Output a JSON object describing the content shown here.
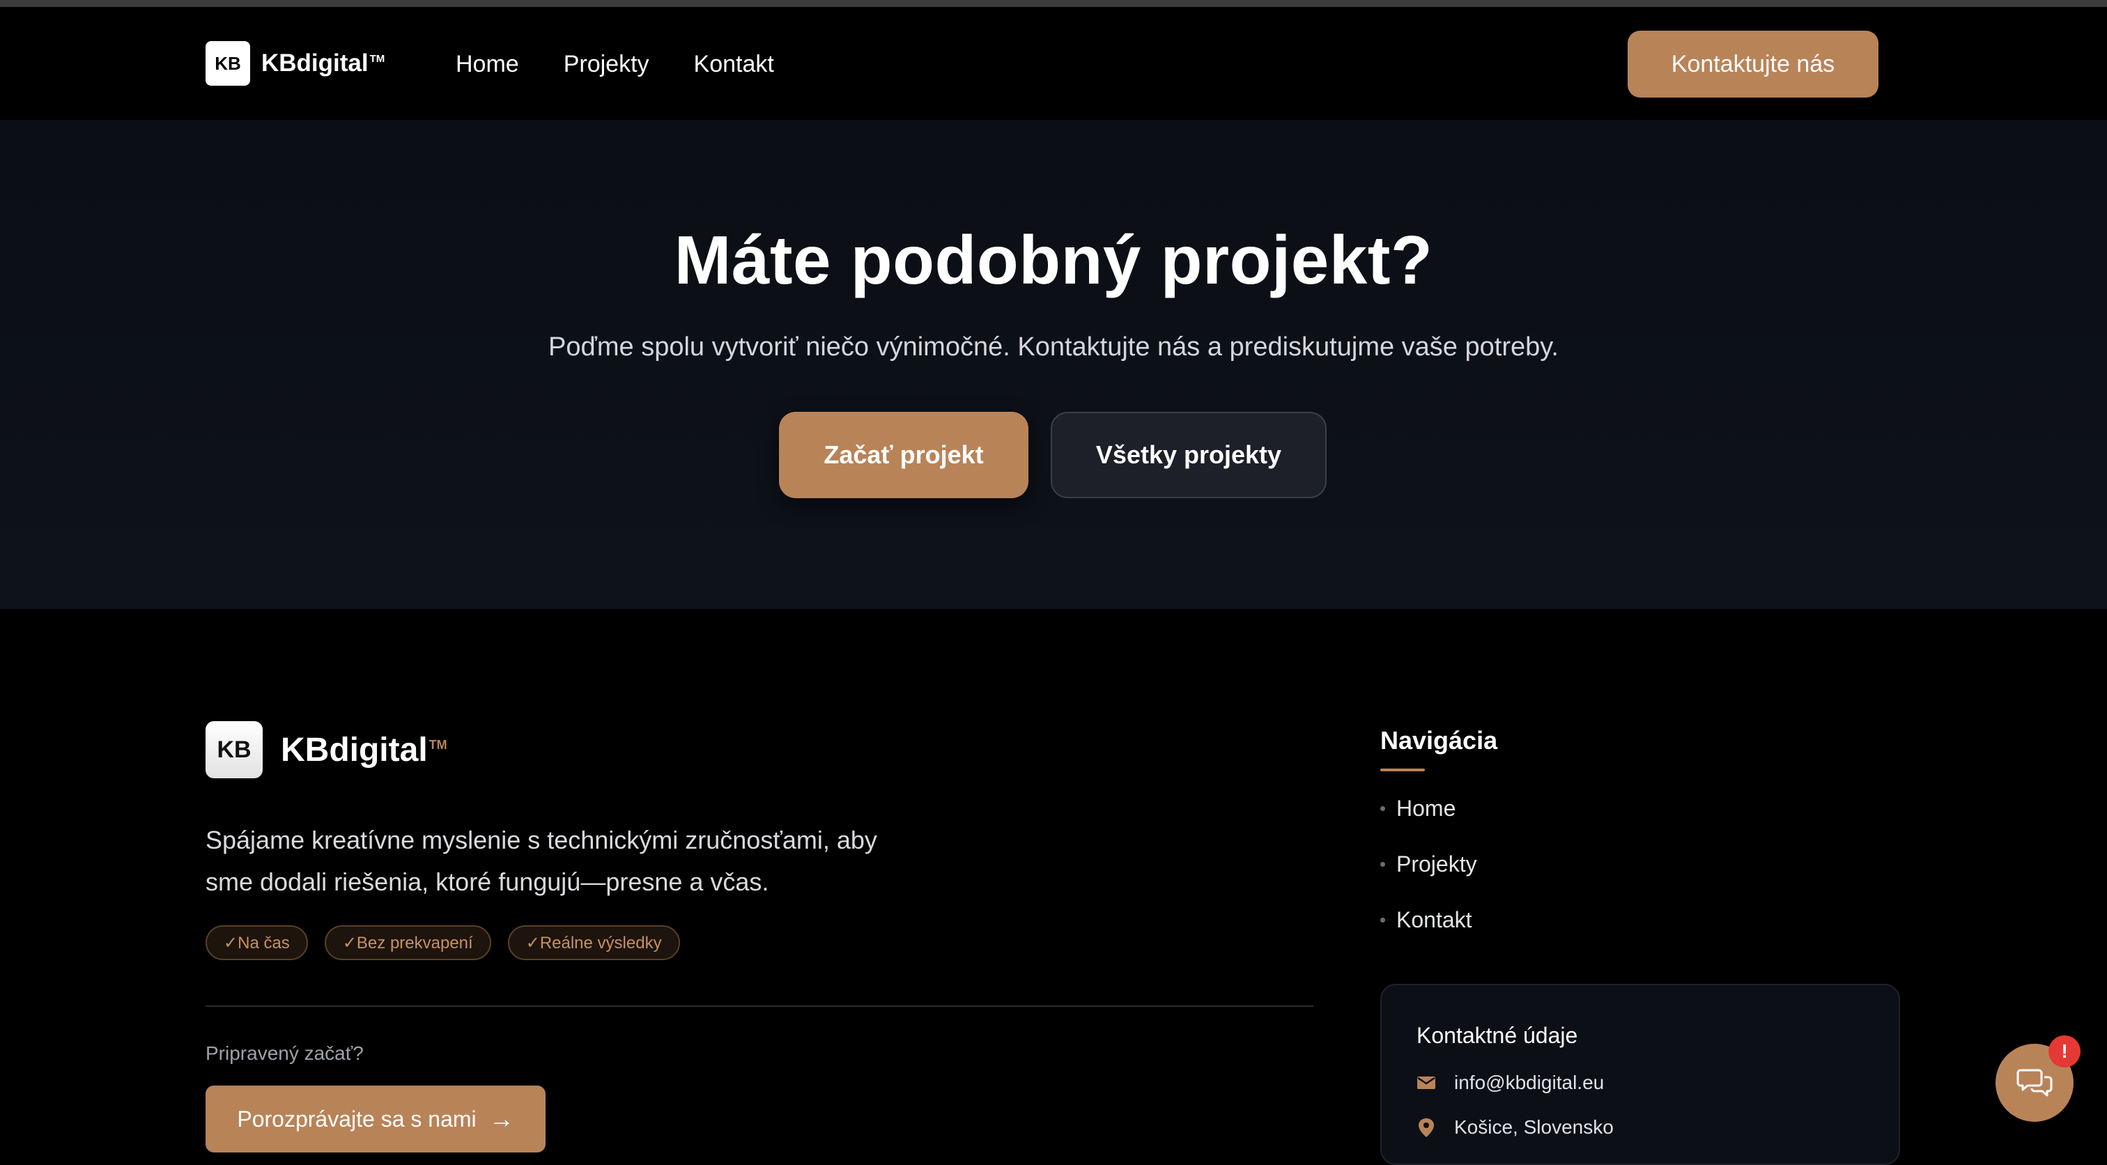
{
  "header": {
    "logo_mark": "KB",
    "brand": "KBdigital",
    "tm": "TM",
    "nav": [
      "Home",
      "Projekty",
      "Kontakt"
    ],
    "cta": "Kontaktujte nás"
  },
  "hero": {
    "title": "Máte podobný projekt?",
    "subtitle": "Poďme spolu vytvoriť niečo výnimočné. Kontaktujte nás a prediskutujme vaše potreby.",
    "primary_button": "Začať projekt",
    "secondary_button": "Všetky projekty"
  },
  "footer": {
    "logo_mark": "KB",
    "brand": "KBdigital",
    "tm": "TM",
    "description": "Spájame kreatívne myslenie s technickými zručnosťami, aby sme dodali riešenia, ktoré fungujú—presne a včas.",
    "badges": [
      "✓Na čas",
      "✓Bez prekvapení",
      "✓Reálne výsledky"
    ],
    "ready_text": "Pripravený začať?",
    "talk_button": "Porozprávajte sa s nami",
    "talk_arrow": "→",
    "nav_title": "Navigácia",
    "nav_items": [
      "Home",
      "Projekty",
      "Kontakt"
    ],
    "contact": {
      "title": "Kontaktné údaje",
      "email": "info@kbdigital.eu",
      "location": "Košice, Slovensko",
      "email_icon": "mail-icon",
      "location_icon": "location-pin-icon"
    }
  },
  "chat": {
    "icon": "chat-bubbles-icon",
    "alert": "!"
  },
  "colors": {
    "accent": "#b98358",
    "background": "#000000",
    "hero_background": "#0c0f16",
    "alert": "#e53935"
  }
}
